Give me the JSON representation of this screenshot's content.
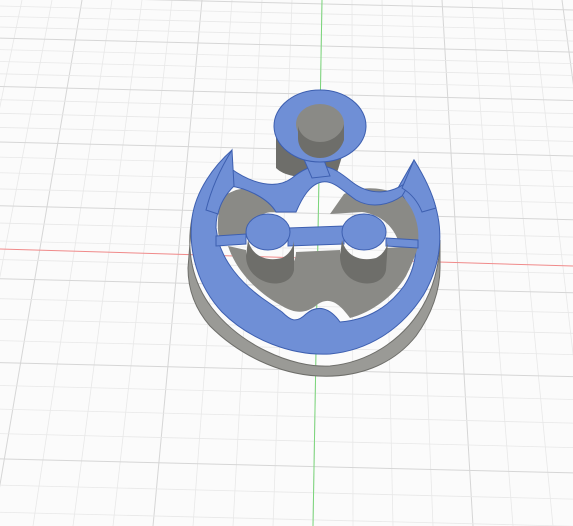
{
  "viewport": {
    "background_color": "#fbfbfb",
    "grid_color": "#d6d6d6",
    "grid_minor_color": "#e8e8e8",
    "x_axis_color": "#f08a8a",
    "y_axis_color": "#7ad67a"
  },
  "model": {
    "name": "anchor-cookie-cutter",
    "top_face_color": "#6f8fd6",
    "top_face_stroke": "#3d5fb0",
    "wall_color": "#9a9a96",
    "wall_shadow_color": "#6e6e6a",
    "inner_wall_color": "#8a8a86"
  }
}
